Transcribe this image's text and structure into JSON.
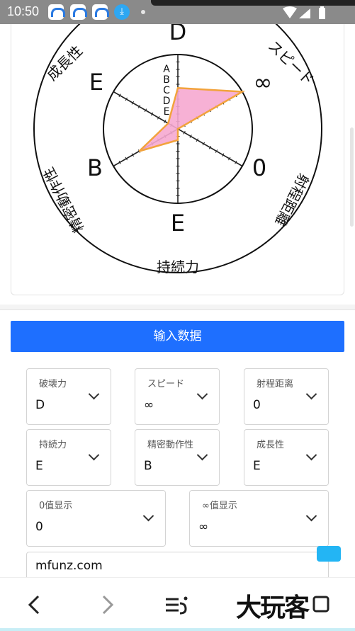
{
  "status_bar": {
    "time": "10:50",
    "download_glyph": "⤓"
  },
  "radar": {
    "scale_letters": [
      "A",
      "B",
      "C",
      "D",
      "E"
    ],
    "axes": [
      {
        "name": "破壊力",
        "value": "D"
      },
      {
        "name": "スピード",
        "value": "∞"
      },
      {
        "name": "射程距離",
        "value": "0"
      },
      {
        "name": "持続力",
        "value": "E"
      },
      {
        "name": "精密動作性",
        "value": "B"
      },
      {
        "name": "成長性",
        "value": "E"
      }
    ],
    "polygon_levels": [
      0.55,
      1.0,
      0.0,
      0.15,
      0.6,
      0.15
    ],
    "fill_color": "#f6a8d0",
    "stroke_color": "#f2a33c"
  },
  "form": {
    "submit_label": "输入数据",
    "fields": [
      {
        "label": "破壊力",
        "value": "D"
      },
      {
        "label": "スピード",
        "value": "∞"
      },
      {
        "label": "射程距离",
        "value": "0"
      },
      {
        "label": "持続力",
        "value": "E"
      },
      {
        "label": "精密動作性",
        "value": "B"
      },
      {
        "label": "成長性",
        "value": "E"
      },
      {
        "label": "0值显示",
        "value": "0"
      },
      {
        "label": "∞值显示",
        "value": "∞"
      }
    ],
    "site_input": "mfunz.com"
  },
  "watermark": "大玩客",
  "accent_color": "#1e6fff"
}
